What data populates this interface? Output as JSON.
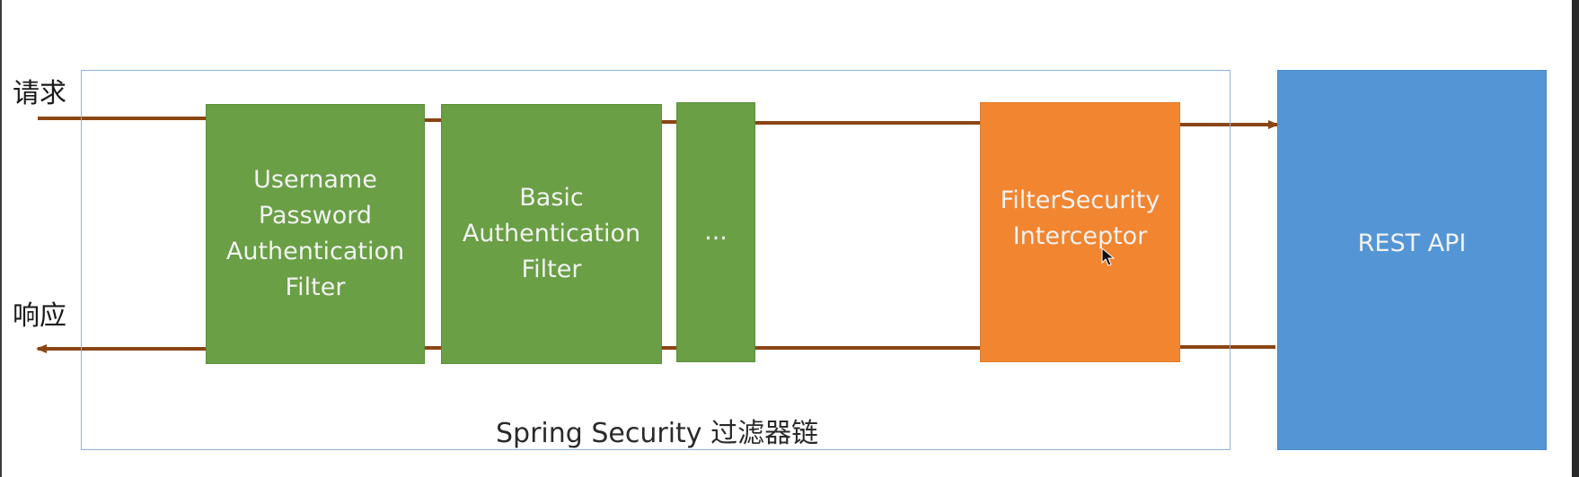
{
  "labels": {
    "request": "请求",
    "response": "响应",
    "chain_caption": "Spring Security 过滤器链"
  },
  "filters": {
    "username_password": "Username\nPassword\nAuthentication\nFilter",
    "basic_auth": "Basic\nAuthentication\nFilter",
    "ellipsis": "...",
    "filter_security_interceptor": "FilterSecurity\nInterceptor"
  },
  "rest_api": "REST API",
  "colors": {
    "filter_green": "#6a9f45",
    "interceptor_orange": "#f28530",
    "api_blue": "#5496d5",
    "arrow_brown": "#8b4513",
    "frame_blue": "#8fb4d9"
  }
}
